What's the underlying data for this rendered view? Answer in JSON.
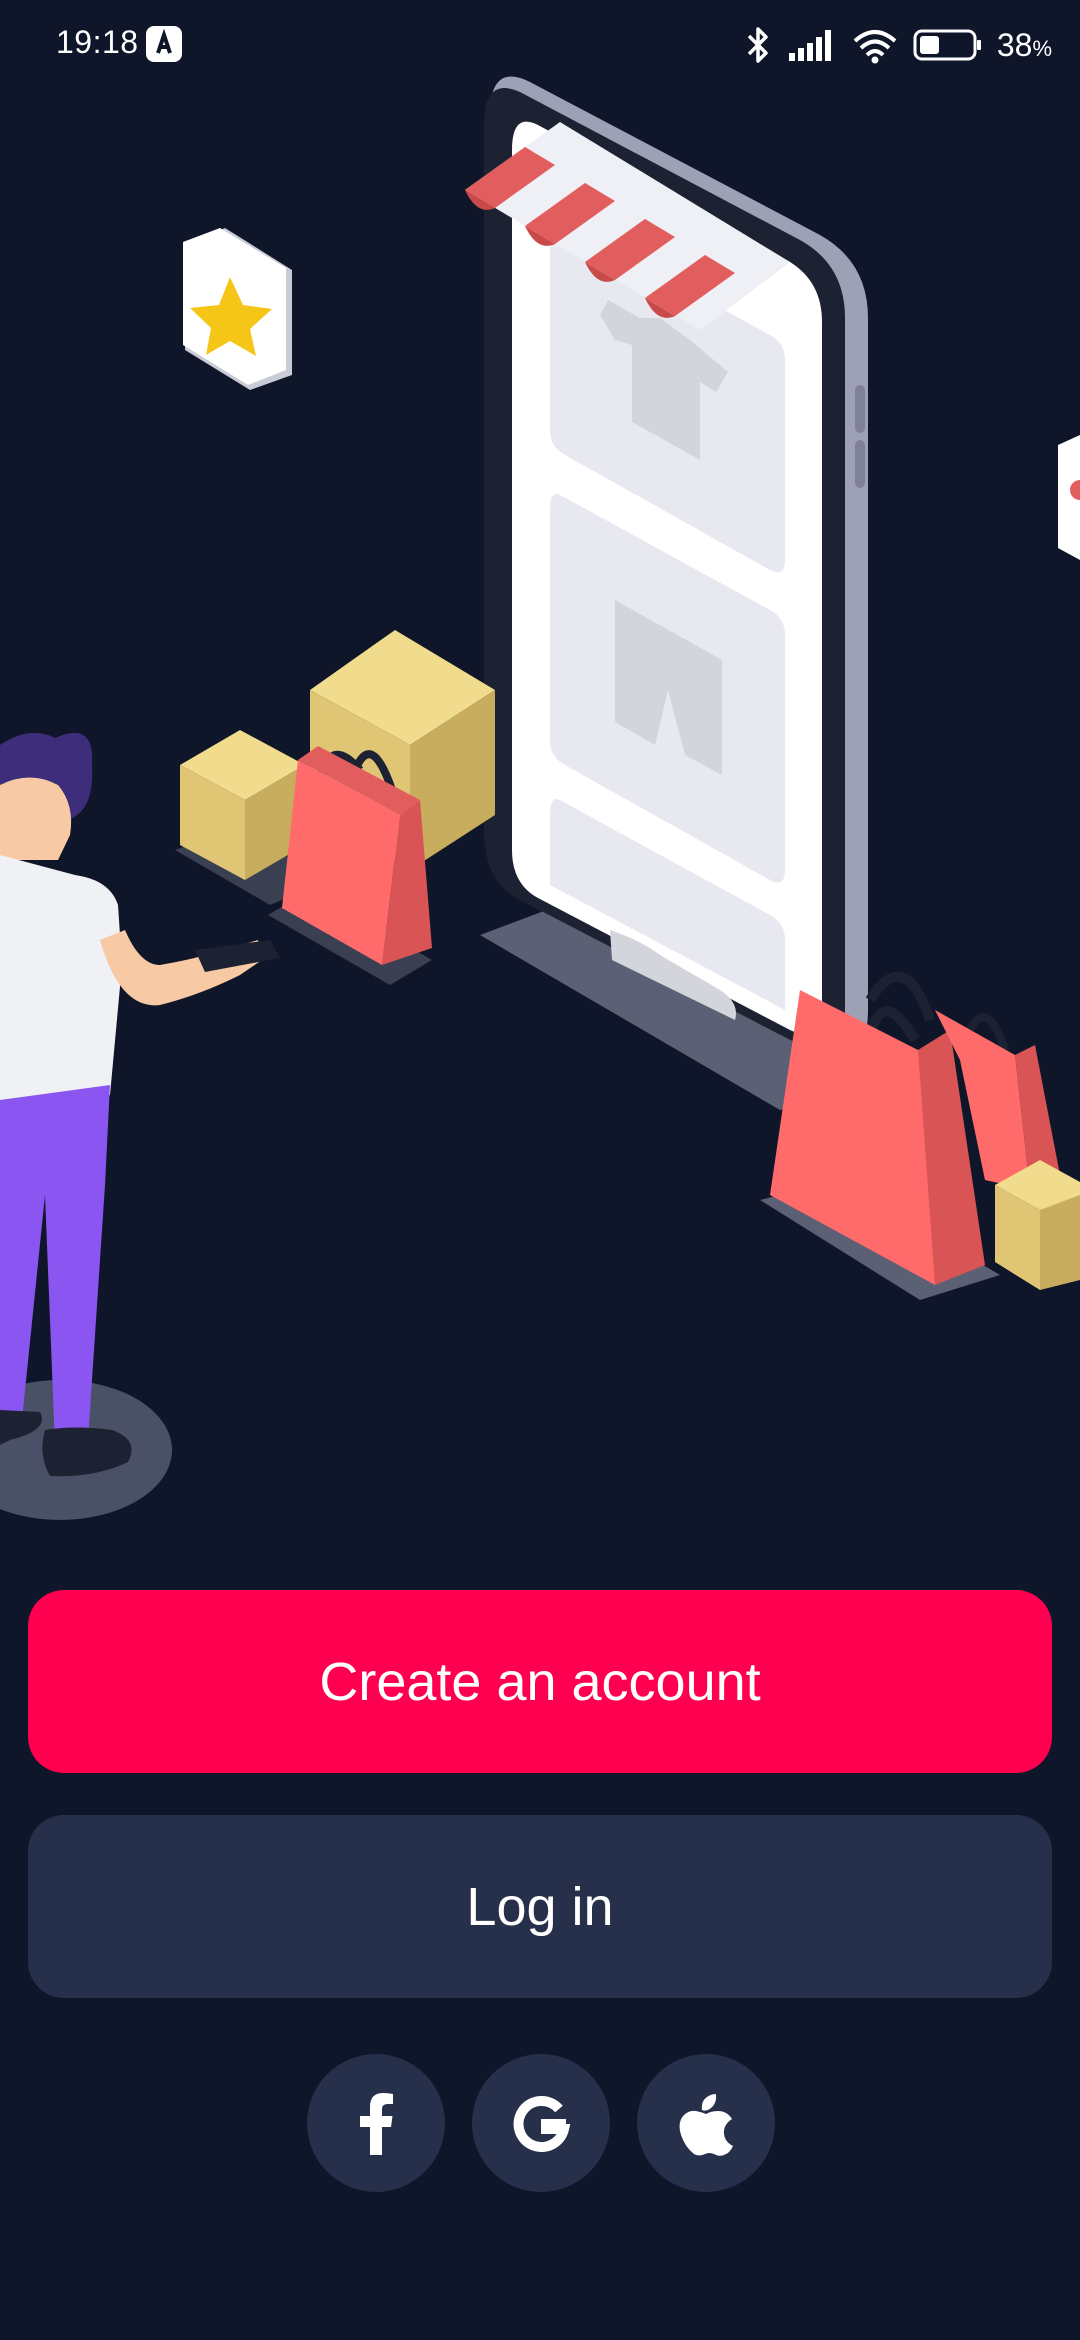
{
  "status_bar": {
    "time": "19:18",
    "battery_percent": "38",
    "battery_unit": "%",
    "battery_level": 0.38,
    "icons": [
      "app-notification-icon",
      "bluetooth-icon",
      "signal-icon",
      "wifi-icon",
      "battery-icon"
    ]
  },
  "colors": {
    "background": "#0f1629",
    "primary": "#ff0050",
    "secondary": "#26304a",
    "text": "#ffffff"
  },
  "actions": {
    "create_account_label": "Create an account",
    "login_label": "Log in"
  },
  "social_login": {
    "buttons": [
      "facebook-icon",
      "google-icon",
      "apple-icon"
    ]
  }
}
